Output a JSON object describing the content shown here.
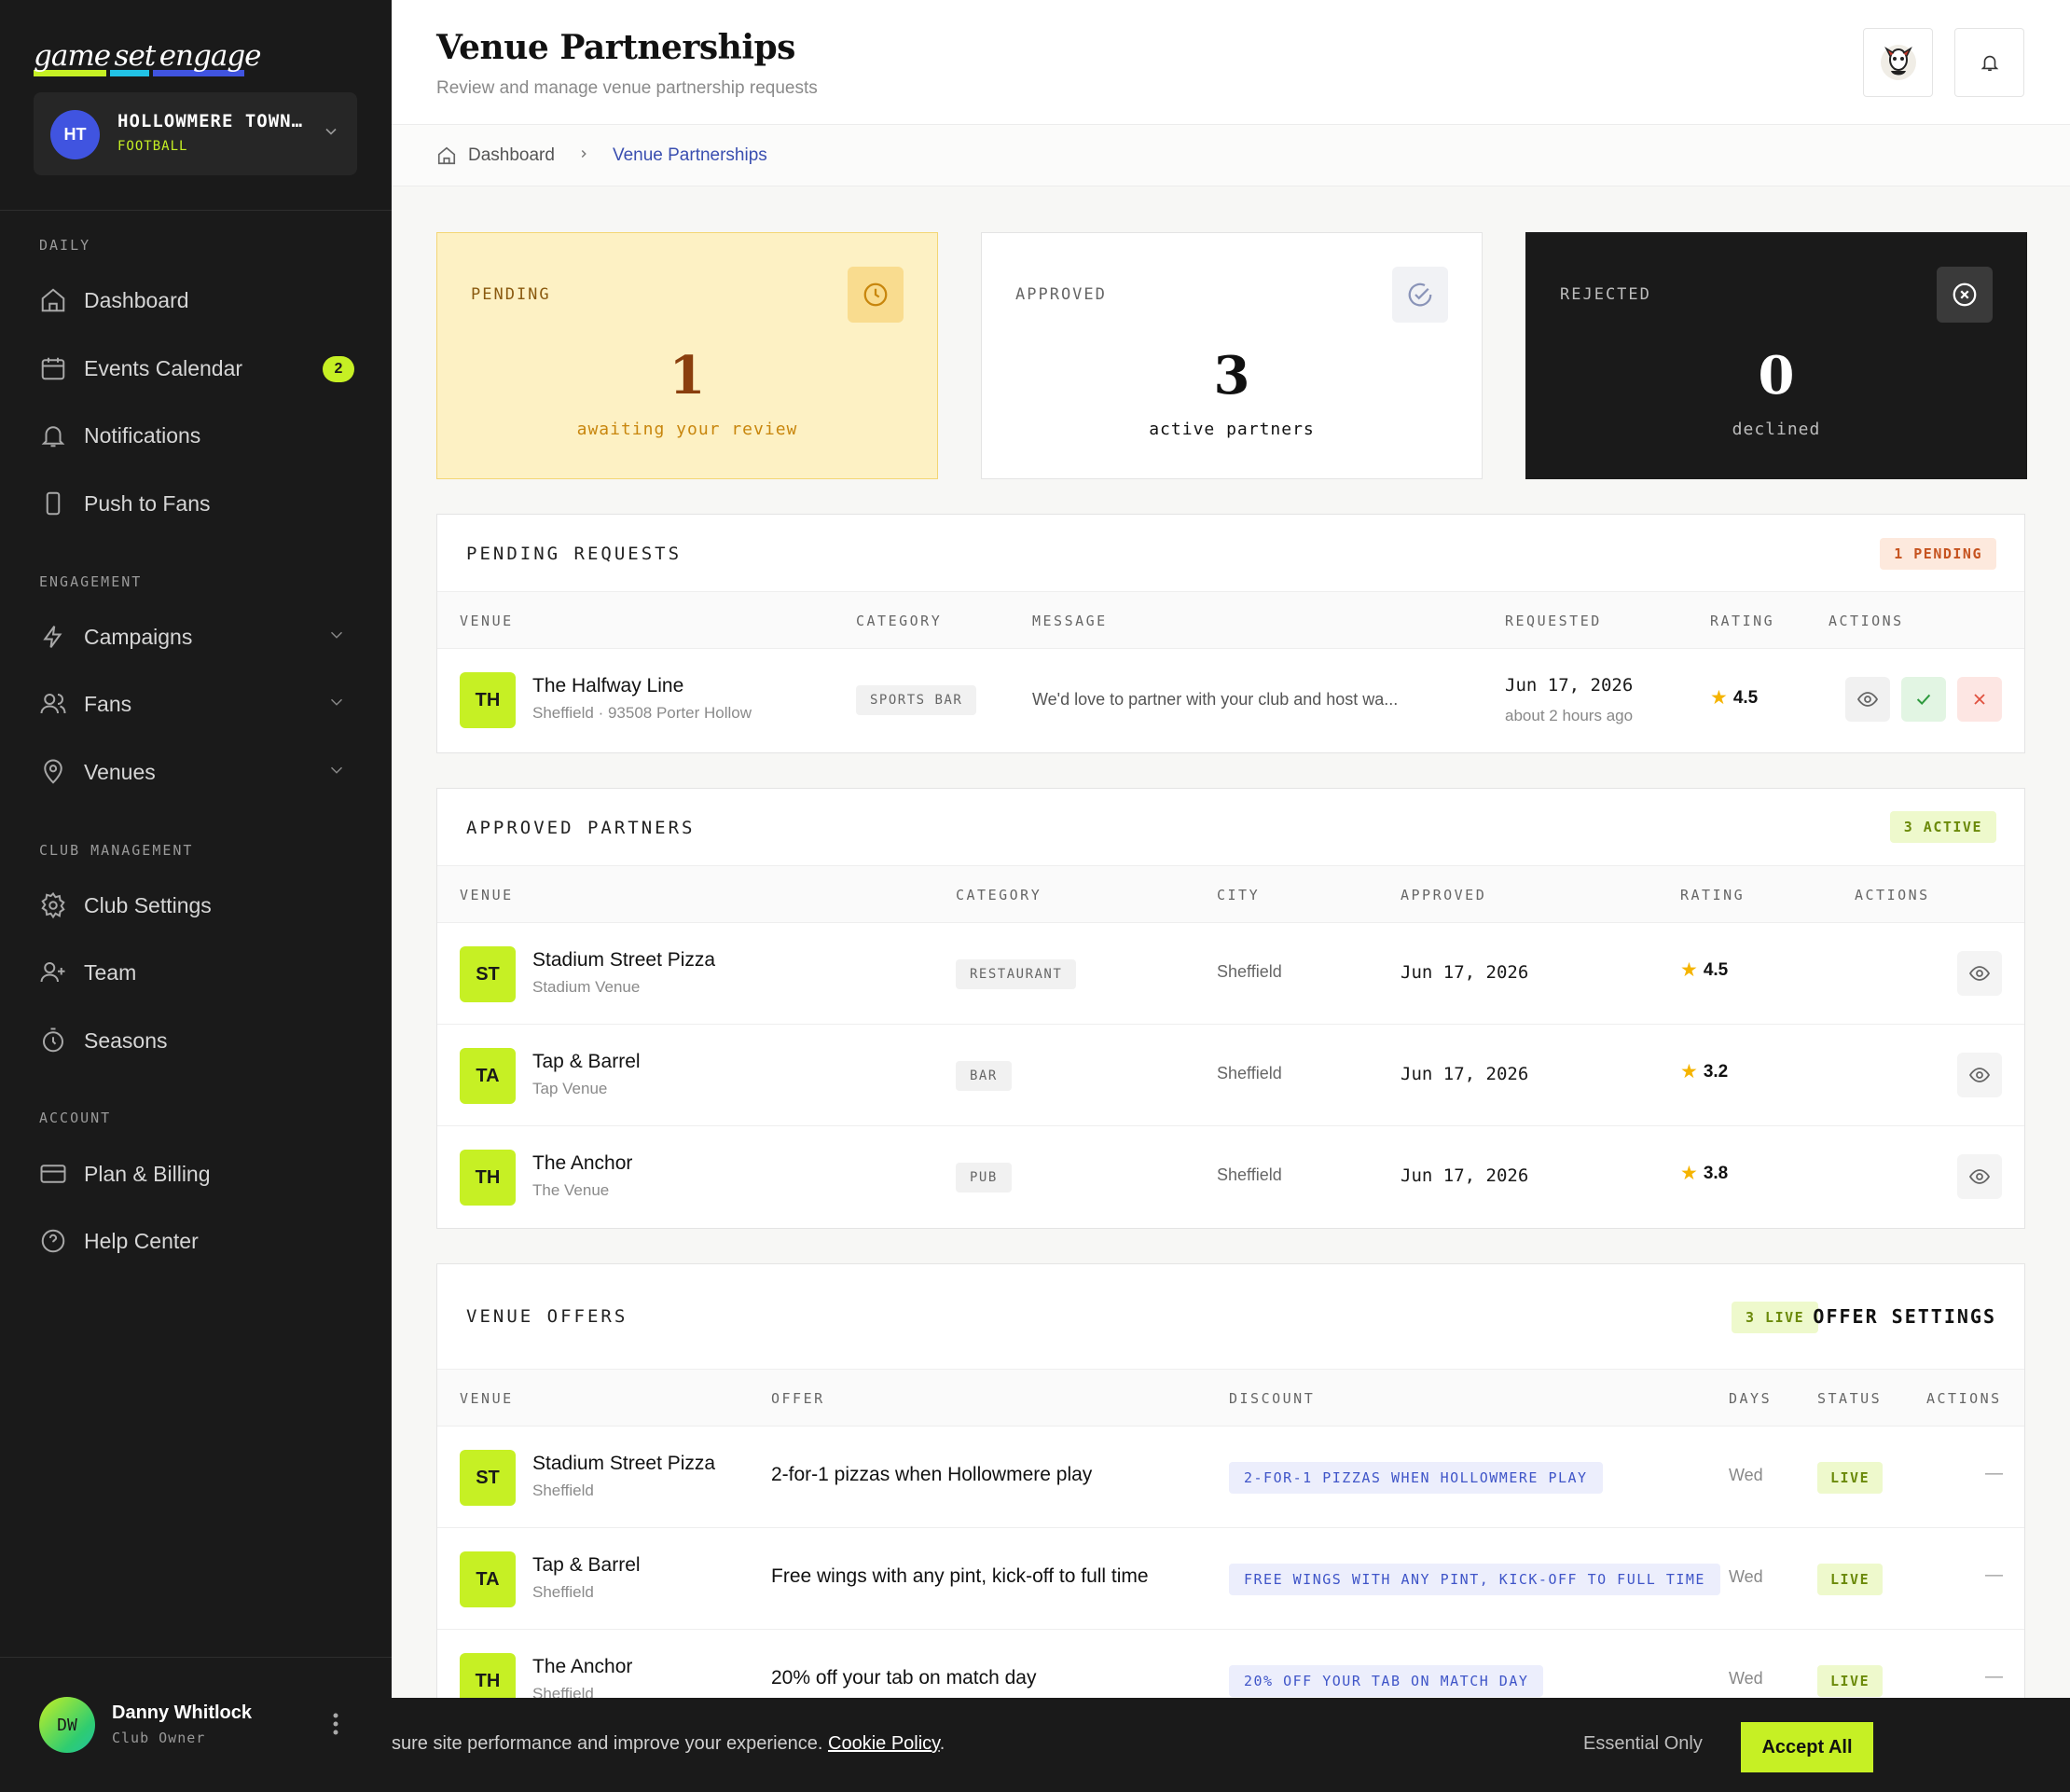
{
  "brand": {
    "word1": "game",
    "word2": "set",
    "word3": "engage",
    "accent": "#c6f024"
  },
  "org": {
    "initials": "HT",
    "name": "HOLLOWMERE TOWN…",
    "sport": "FOOTBALL"
  },
  "sidebar": {
    "sections": {
      "daily": "DAILY",
      "engagement": "ENGAGEMENT",
      "club": "CLUB MANAGEMENT",
      "account": "ACCOUNT"
    },
    "items": {
      "dashboard": "Dashboard",
      "events": "Events Calendar",
      "events_badge": "2",
      "notifications": "Notifications",
      "push": "Push to Fans",
      "campaigns": "Campaigns",
      "fans": "Fans",
      "venues": "Venues",
      "settings": "Club Settings",
      "team": "Team",
      "seasons": "Seasons",
      "billing": "Plan & Billing",
      "help": "Help Center"
    },
    "user": {
      "initials": "DW",
      "name": "Danny Whitlock",
      "role": "Club Owner"
    }
  },
  "header": {
    "title": "Venue Partnerships",
    "subtitle": "Review and manage venue partnership requests"
  },
  "breadcrumb": {
    "home": "Dashboard",
    "current": "Venue Partnerships"
  },
  "stats": {
    "pending": {
      "label": "PENDING",
      "value": "1",
      "caption": "awaiting your review"
    },
    "approved": {
      "label": "APPROVED",
      "value": "3",
      "caption": "active partners"
    },
    "rejected": {
      "label": "REJECTED",
      "value": "0",
      "caption": "declined"
    }
  },
  "pending": {
    "title": "PENDING REQUESTS",
    "badge": "1 PENDING",
    "columns": [
      "VENUE",
      "CATEGORY",
      "MESSAGE",
      "REQUESTED",
      "RATING",
      "ACTIONS"
    ],
    "rows": [
      {
        "initials": "TH",
        "name": "The Halfway Line",
        "sub": "Sheffield · 93508 Porter Hollow",
        "category": "SPORTS BAR",
        "message": "We'd love to partner with your club and host wa...",
        "date": "Jun 17, 2026",
        "ago": "about 2 hours ago",
        "rating": "4.5"
      }
    ]
  },
  "approved": {
    "title": "APPROVED PARTNERS",
    "badge": "3 ACTIVE",
    "columns": [
      "VENUE",
      "CATEGORY",
      "CITY",
      "APPROVED",
      "RATING",
      "ACTIONS"
    ],
    "rows": [
      {
        "initials": "ST",
        "name": "Stadium Street Pizza",
        "sub": "Stadium Venue",
        "category": "RESTAURANT",
        "city": "Sheffield",
        "date": "Jun 17, 2026",
        "rating": "4.5"
      },
      {
        "initials": "TA",
        "name": "Tap & Barrel",
        "sub": "Tap Venue",
        "category": "BAR",
        "city": "Sheffield",
        "date": "Jun 17, 2026",
        "rating": "3.2"
      },
      {
        "initials": "TH",
        "name": "The Anchor",
        "sub": "The Venue",
        "category": "PUB",
        "city": "Sheffield",
        "date": "Jun 17, 2026",
        "rating": "3.8"
      }
    ]
  },
  "offers": {
    "title": "VENUE OFFERS",
    "badge": "3 LIVE",
    "settings": "OFFER SETTINGS",
    "columns": [
      "VENUE",
      "OFFER",
      "DISCOUNT",
      "DAYS",
      "STATUS",
      "ACTIONS"
    ],
    "rows": [
      {
        "initials": "ST",
        "name": "Stadium Street Pizza",
        "sub": "Sheffield",
        "offer": "2-for-1 pizzas when Hollowmere play",
        "discount": "2-FOR-1 PIZZAS WHEN HOLLOWMERE PLAY",
        "days": "Wed",
        "status": "LIVE",
        "action": "—"
      },
      {
        "initials": "TA",
        "name": "Tap & Barrel",
        "sub": "Sheffield",
        "offer": "Free wings with any pint, kick-off to full time",
        "discount": "FREE WINGS WITH ANY PINT, KICK-OFF TO FULL TIME",
        "days": "Wed",
        "status": "LIVE",
        "action": "—"
      },
      {
        "initials": "TH",
        "name": "The Anchor",
        "sub": "Sheffield",
        "offer": "20% off your tab on match day",
        "discount": "20% OFF YOUR TAB ON MATCH DAY",
        "days": "Wed",
        "status": "LIVE",
        "action": "—"
      }
    ]
  },
  "cookie": {
    "text": "sure site performance and improve your experience.",
    "link": "Cookie Policy",
    "period": ".",
    "essential": "Essential Only",
    "accept": "Accept All"
  }
}
